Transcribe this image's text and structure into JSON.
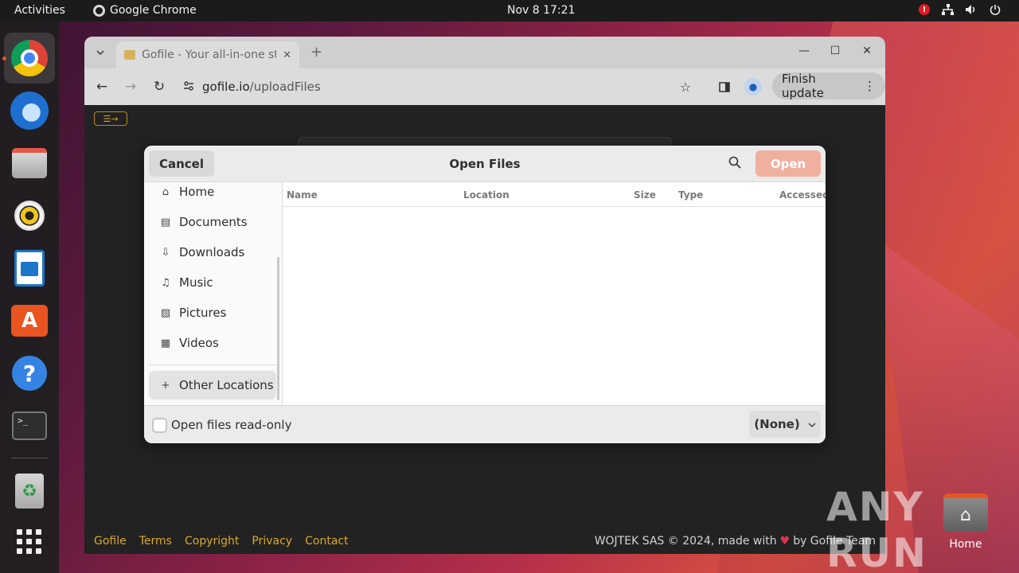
{
  "topbar": {
    "activities": "Activities",
    "app_name": "Google Chrome",
    "clock": "Nov 8  17:21",
    "alert": "!"
  },
  "dock": {
    "items": [
      "google-chrome",
      "thunderbird",
      "files",
      "rhythmbox",
      "libreoffice-writer",
      "app-center",
      "help",
      "terminal",
      "trash",
      "show-apps"
    ],
    "term_glyph": ">_",
    "trash_glyph": "♻",
    "store_glyph": "A",
    "help_glyph": "?"
  },
  "browser": {
    "tab_title": "Gofile - Your all-in-one st",
    "url_host": "gofile.io",
    "url_path": "/uploadFiles",
    "finish_update": "Finish update",
    "menu_glyph": "☰→"
  },
  "page": {
    "footer_links": [
      "Gofile",
      "Terms",
      "Copyright",
      "Privacy",
      "Contact"
    ],
    "footer_left_text": "WOJTEK SAS © 2024, made with",
    "footer_right_text": "by Gofile Team"
  },
  "dialog": {
    "title": "Open Files",
    "cancel_label": "Cancel",
    "open_label": "Open",
    "places": [
      {
        "label": "Home",
        "icon": "home-icon",
        "glyph": "⌂"
      },
      {
        "label": "Documents",
        "icon": "document-icon",
        "glyph": "▤"
      },
      {
        "label": "Downloads",
        "icon": "download-icon",
        "glyph": "⇩"
      },
      {
        "label": "Music",
        "icon": "music-icon",
        "glyph": "♫"
      },
      {
        "label": "Pictures",
        "icon": "picture-icon",
        "glyph": "▧"
      },
      {
        "label": "Videos",
        "icon": "video-icon",
        "glyph": "▦"
      }
    ],
    "other_locations": "Other Locations",
    "columns": [
      "Name",
      "Location",
      "Size",
      "Type",
      "Accessed"
    ],
    "read_only_label": "Open files read-only",
    "filter_value": "(None)"
  },
  "desktop": {
    "home_label": "Home",
    "watermark": "ANY RUN"
  },
  "colors": {
    "accent": "#e95420",
    "gofile_link": "#d9a929",
    "open_button": "#f0b0a0"
  }
}
